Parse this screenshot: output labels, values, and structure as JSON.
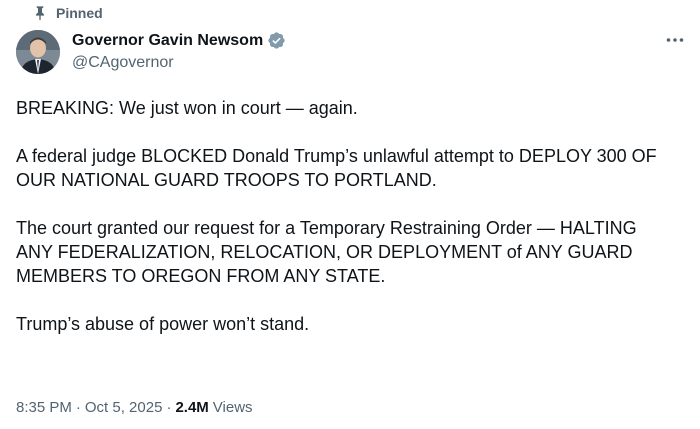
{
  "pinned": {
    "label": "Pinned",
    "icon": "pin-icon"
  },
  "author": {
    "name": "Governor Gavin Newsom",
    "handle": "@CAgovernor",
    "verified_icon": "verified-badge-icon",
    "verified_color": "#829aab"
  },
  "more_icon": "more-options-icon",
  "tweet": {
    "paragraphs": [
      "BREAKING: We just won in court — again.",
      "A federal judge BLOCKED Donald Trump’s unlawful attempt to DEPLOY 300 OF OUR NATIONAL GUARD TROOPS TO PORTLAND.",
      "The court granted our request for a Temporary Restraining Order — HALTING ANY FEDERALIZATION, RELOCATION, OR DEPLOYMENT of ANY GUARD MEMBERS TO OREGON FROM ANY STATE.",
      "Trump’s abuse of power won’t stand."
    ]
  },
  "meta": {
    "time": "8:35 PM",
    "date": "Oct 5, 2025",
    "separator": "·",
    "views_count": "2.4M",
    "views_label": "Views"
  }
}
